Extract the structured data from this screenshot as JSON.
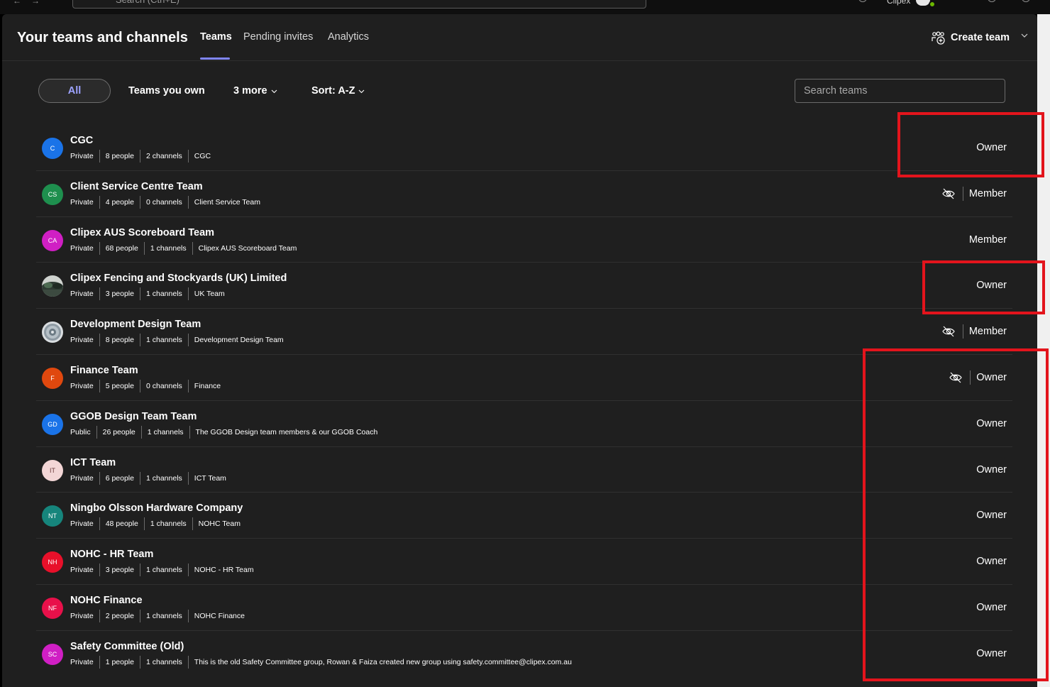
{
  "colors": {
    "accent": "#7f85f5",
    "annotation": "#e3141c",
    "background": "#1f1f1f"
  },
  "topbar": {
    "search_placeholder": "Search (Ctrl+E)",
    "user_name": "Clipex"
  },
  "header": {
    "title": "Your teams and channels",
    "tabs": [
      {
        "label": "Teams",
        "active": true
      },
      {
        "label": "Pending invites",
        "active": false
      },
      {
        "label": "Analytics",
        "active": false
      }
    ],
    "create_team_label": "Create team",
    "create_icon": "add-team-icon"
  },
  "filters": {
    "all_label": "All",
    "owned_label": "Teams you own",
    "more_label": "3 more",
    "sort_label": "Sort: A-Z",
    "search_placeholder": "Search teams"
  },
  "teams": [
    {
      "initials": "C",
      "avatar_color": "#1a73e8",
      "name": "CGC",
      "privacy": "Private",
      "people": "8 people",
      "channels": "2 channels",
      "description": "CGC",
      "hidden": false,
      "role": "Owner"
    },
    {
      "initials": "CS",
      "avatar_color": "#1e8f4e",
      "name": "Client Service Centre Team",
      "privacy": "Private",
      "people": "4 people",
      "channels": "0 channels",
      "description": "Client Service Team",
      "hidden": true,
      "role": "Member"
    },
    {
      "initials": "CA",
      "avatar_color": "#d01fc4",
      "name": "Clipex AUS Scoreboard Team",
      "privacy": "Private",
      "people": "68 people",
      "channels": "1 channels",
      "description": "Clipex AUS Scoreboard Team",
      "hidden": false,
      "role": "Member"
    },
    {
      "initials": "",
      "avatar_color": "photo",
      "name": "Clipex Fencing and Stockyards (UK) Limited",
      "privacy": "Private",
      "people": "3 people",
      "channels": "1 channels",
      "description": "UK Team",
      "hidden": false,
      "role": "Owner"
    },
    {
      "initials": "",
      "avatar_color": "emblem",
      "name": "Development Design Team",
      "privacy": "Private",
      "people": "8 people",
      "channels": "1 channels",
      "description": "Development Design Team",
      "hidden": true,
      "role": "Member"
    },
    {
      "initials": "F",
      "avatar_color": "#e0480e",
      "name": "Finance Team",
      "privacy": "Private",
      "people": "5 people",
      "channels": "0 channels",
      "description": "Finance",
      "hidden": true,
      "role": "Owner"
    },
    {
      "initials": "GD",
      "avatar_color": "#1a73e8",
      "name": "GGOB Design Team Team",
      "privacy": "Public",
      "people": "26 people",
      "channels": "1 channels",
      "description": "The GGOB Design team members & our GGOB Coach",
      "hidden": false,
      "role": "Owner"
    },
    {
      "initials": "IT",
      "avatar_color": "#f3d6d6",
      "name": "ICT Team",
      "privacy": "Private",
      "people": "6 people",
      "channels": "1 channels",
      "description": "ICT Team",
      "hidden": false,
      "role": "Owner"
    },
    {
      "initials": "NT",
      "avatar_color": "#16857c",
      "name": "Ningbo Olsson Hardware Company",
      "privacy": "Private",
      "people": "48 people",
      "channels": "1 channels",
      "description": "NOHC Team",
      "hidden": false,
      "role": "Owner"
    },
    {
      "initials": "NH",
      "avatar_color": "#e8102a",
      "name": "NOHC - HR Team",
      "privacy": "Private",
      "people": "3 people",
      "channels": "1 channels",
      "description": "NOHC - HR Team",
      "hidden": false,
      "role": "Owner"
    },
    {
      "initials": "NF",
      "avatar_color": "#e8104a",
      "name": "NOHC Finance",
      "privacy": "Private",
      "people": "2 people",
      "channels": "1 channels",
      "description": "NOHC Finance",
      "hidden": false,
      "role": "Owner"
    },
    {
      "initials": "SC",
      "avatar_color": "#d01fc4",
      "name": "Safety Committee (Old)",
      "privacy": "Private",
      "people": "1 people",
      "channels": "1 channels",
      "description": "This is the old Safety Committee group, Rowan & Faiza created new group using safety.committee@clipex.com.au",
      "hidden": false,
      "role": "Owner"
    }
  ]
}
